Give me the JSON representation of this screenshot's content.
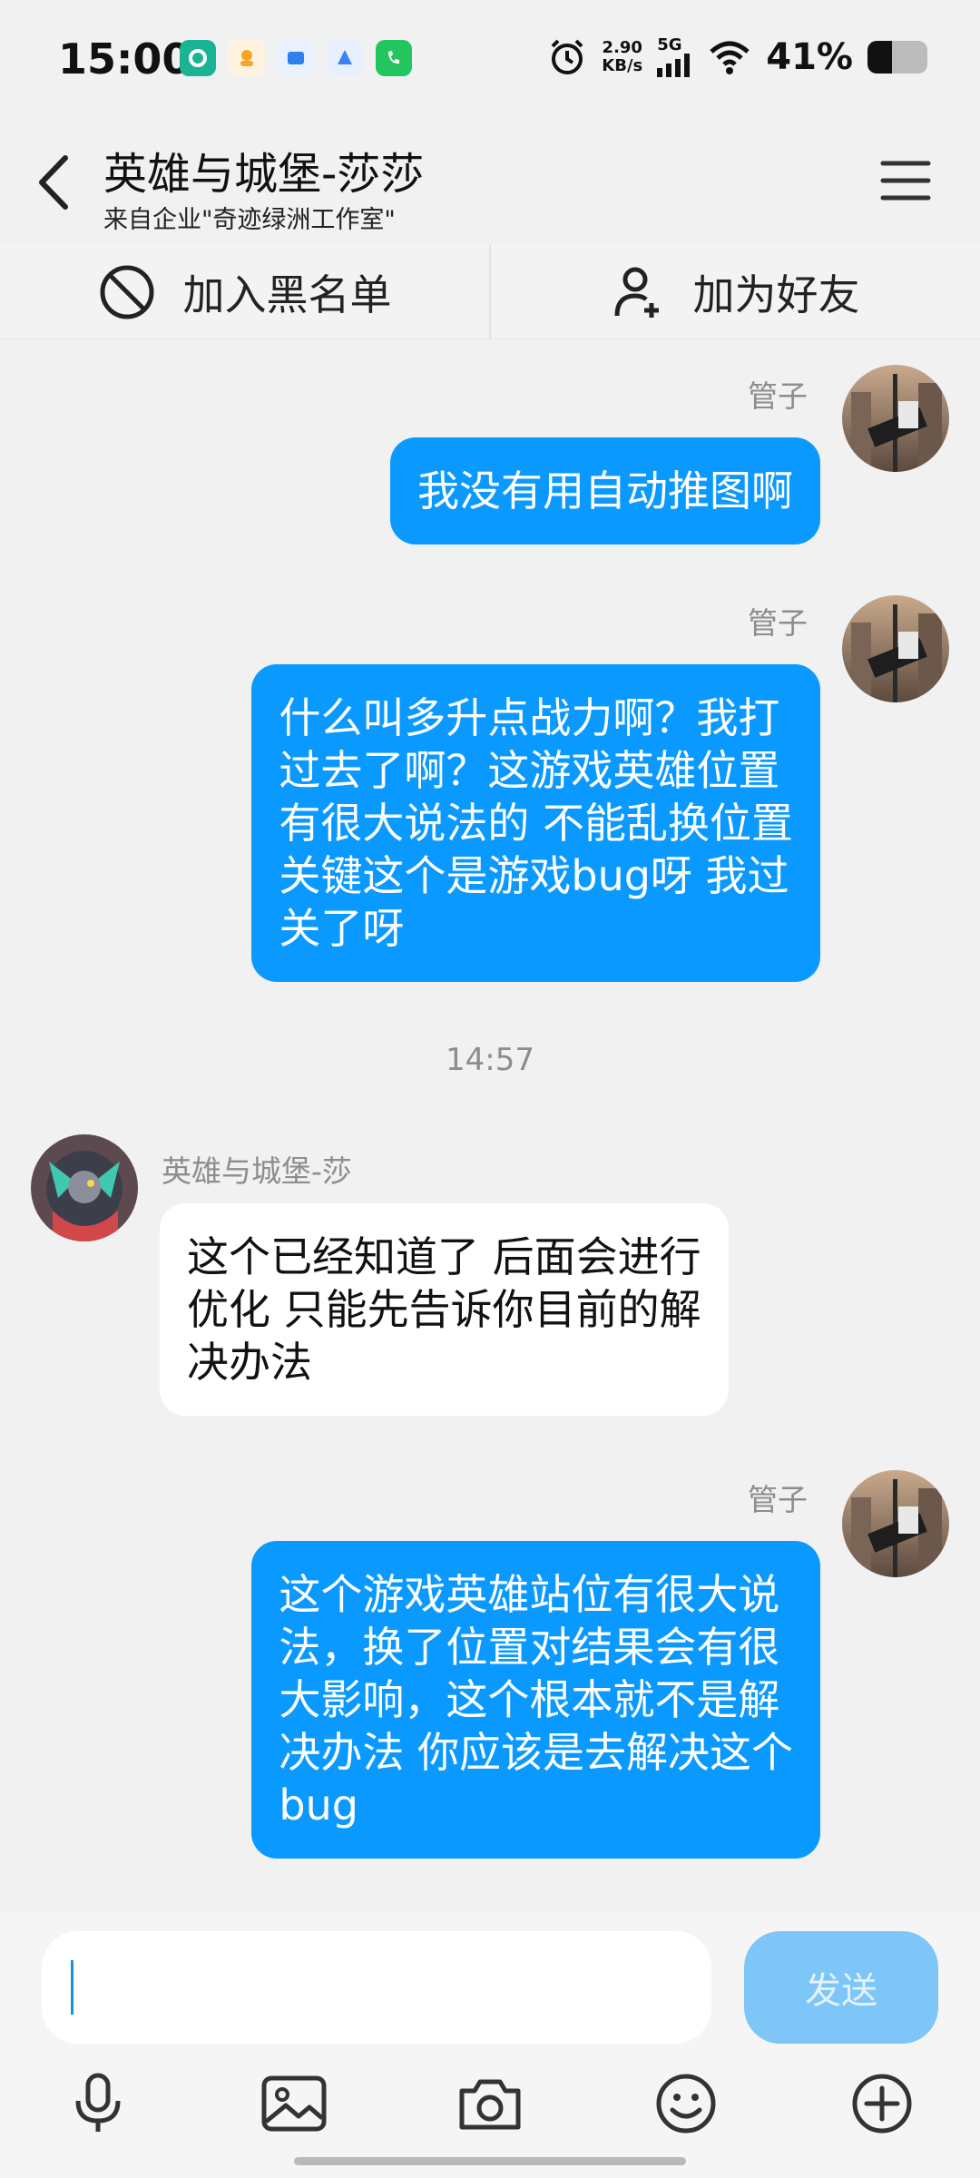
{
  "status_bar": {
    "time": "15:00",
    "net_speed_value": "2.90",
    "net_speed_unit": "KB/s",
    "network_type": "5G",
    "battery_percent": "41%",
    "battery_level": 0.41,
    "app_icon_colors": [
      "#1ab394",
      "#f5a623",
      "#2f80ed",
      "#3b82f6",
      "#22c55e"
    ]
  },
  "header": {
    "title": "英雄与城堡-莎莎",
    "subtitle": "来自企业\"奇迹绿洲工作室\"",
    "back_icon": "chevron-left-icon",
    "menu_icon": "hamburger-menu-icon"
  },
  "actions": {
    "block_label": "加入黑名单",
    "block_icon": "ban-icon",
    "add_friend_label": "加为好友",
    "add_friend_icon": "add-user-icon"
  },
  "messages": [
    {
      "direction": "out",
      "sender": "管子",
      "text": "我没有用自动推图啊"
    },
    {
      "direction": "out",
      "sender": "管子",
      "text": "什么叫多升点战力啊？我打\n过去了啊？这游戏英雄位置\n有很大说法的 不能乱换位置\n关键这个是游戏bug呀 我过\n关了呀"
    },
    {
      "direction": "time",
      "text": "14:57"
    },
    {
      "direction": "in",
      "sender": "英雄与城堡-莎",
      "text": "这个已经知道了 后面会进行\n优化 只能先告诉你目前的解\n决办法"
    },
    {
      "direction": "out",
      "sender": "管子",
      "text": "这个游戏英雄站位有很大说\n法，换了位置对结果会有很\n大影响，这个根本就不是解\n决办法 你应该是去解决这个\nbug"
    }
  ],
  "input": {
    "value": "",
    "send_label": "发送"
  },
  "toolbar": {
    "icons": [
      "microphone-icon",
      "image-icon",
      "camera-icon",
      "emoji-icon",
      "plus-circle-icon"
    ]
  },
  "colors": {
    "outgoing_bubble": "#0a99ff",
    "incoming_bubble": "#ffffff",
    "send_button": "#7ec6f7",
    "background": "#f1f1f1"
  }
}
